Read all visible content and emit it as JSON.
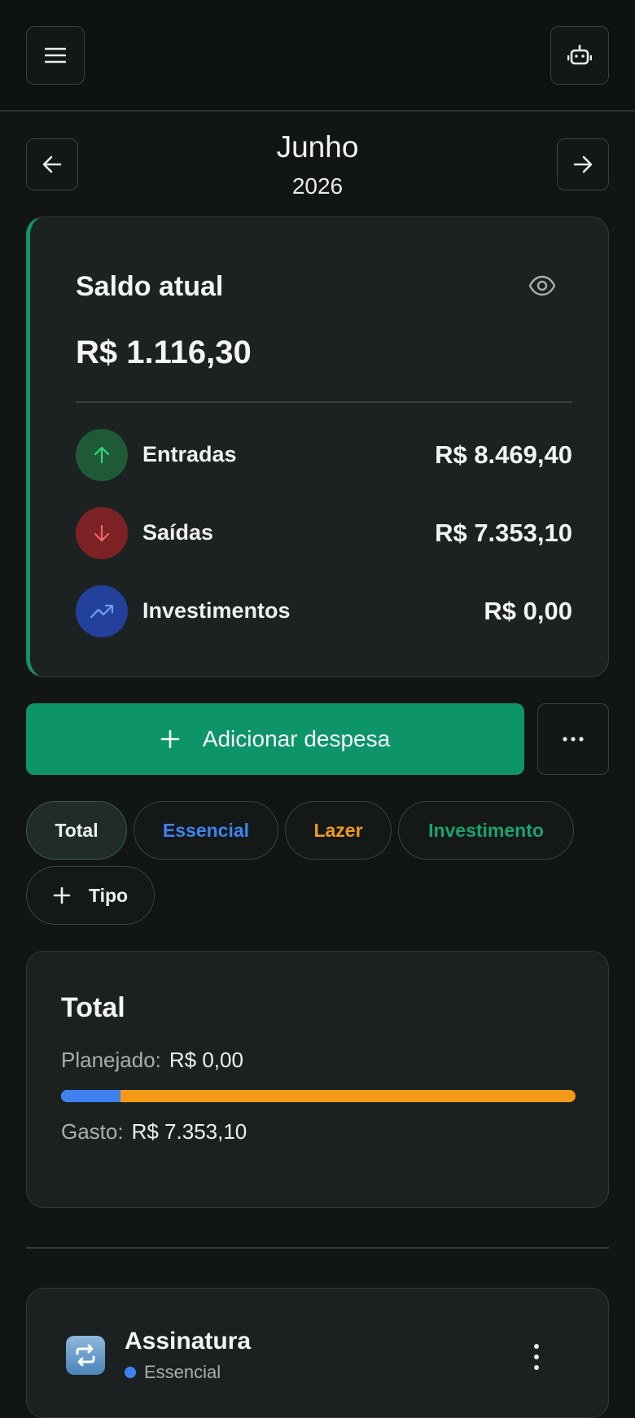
{
  "header": {
    "menu_icon": "hamburger-icon",
    "assistant_icon": "robot-icon"
  },
  "period": {
    "month": "Junho",
    "year": "2026",
    "prev_icon": "arrow-left-icon",
    "next_icon": "arrow-right-icon"
  },
  "balance": {
    "label": "Saldo atual",
    "value": "R$ 1.116,30",
    "rows": [
      {
        "label": "Entradas",
        "value": "R$ 8.469,40",
        "icon": "arrow-up-icon",
        "color": "#1f5a37"
      },
      {
        "label": "Saídas",
        "value": "R$ 7.353,10",
        "icon": "arrow-down-icon",
        "color": "#7d2224"
      },
      {
        "label": "Investimentos",
        "value": "R$ 0,00",
        "icon": "trending-up-icon",
        "color": "#23409a"
      }
    ]
  },
  "actions": {
    "add_label": "Adicionar despesa",
    "more_icon": "more-horizontal-icon"
  },
  "filters": {
    "chips": [
      "Total",
      "Essencial",
      "Lazer",
      "Investimento"
    ],
    "add_type_label": "Tipo"
  },
  "summary": {
    "title": "Total",
    "planned_label": "Planejado:",
    "planned_value": "R$ 0,00",
    "spent_label": "Gasto:",
    "spent_value": "R$ 7.353,10",
    "bar_split_fraction": 0.115,
    "colors": {
      "essencial": "#3f82ef",
      "lazer": "#f29a18",
      "investimento": "#1aa36f",
      "accent": "#0e9469"
    }
  },
  "expenses": [
    {
      "name": "Assinatura",
      "category": "Essencial",
      "icon": "recurring-icon"
    }
  ]
}
